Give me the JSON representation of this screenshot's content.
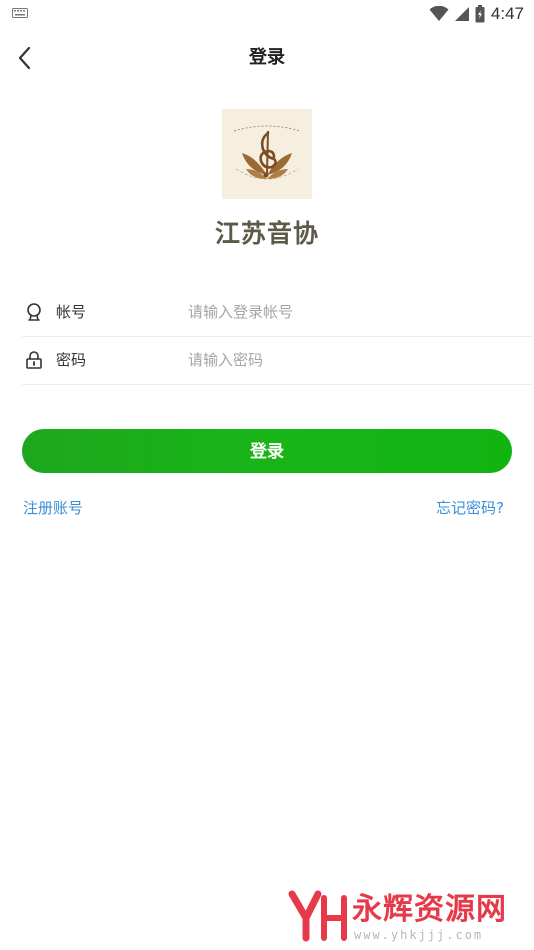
{
  "status_bar": {
    "time": "4:47",
    "icons": [
      "keyboard-icon",
      "wifi-icon",
      "signal-icon",
      "battery-icon"
    ]
  },
  "header": {
    "title": "登录",
    "back_icon": "chevron-left-icon"
  },
  "org": {
    "name": "江苏音协"
  },
  "form": {
    "account": {
      "label": "帐号",
      "placeholder": "请输入登录帐号",
      "value": "",
      "icon": "user-icon"
    },
    "password": {
      "label": "密码",
      "placeholder": "请输入密码",
      "value": "",
      "icon": "lock-icon"
    }
  },
  "actions": {
    "login_label": "登录",
    "register_label": "注册账号",
    "forgot_label": "忘记密码?"
  },
  "watermark": {
    "text": "永辉资源网",
    "url": "www.yhkjjj.com"
  },
  "colors": {
    "primary_green": "#19b419",
    "link_blue": "#3a8fd6",
    "org_name": "#5c5a48",
    "watermark_red": "#e63a4a"
  }
}
